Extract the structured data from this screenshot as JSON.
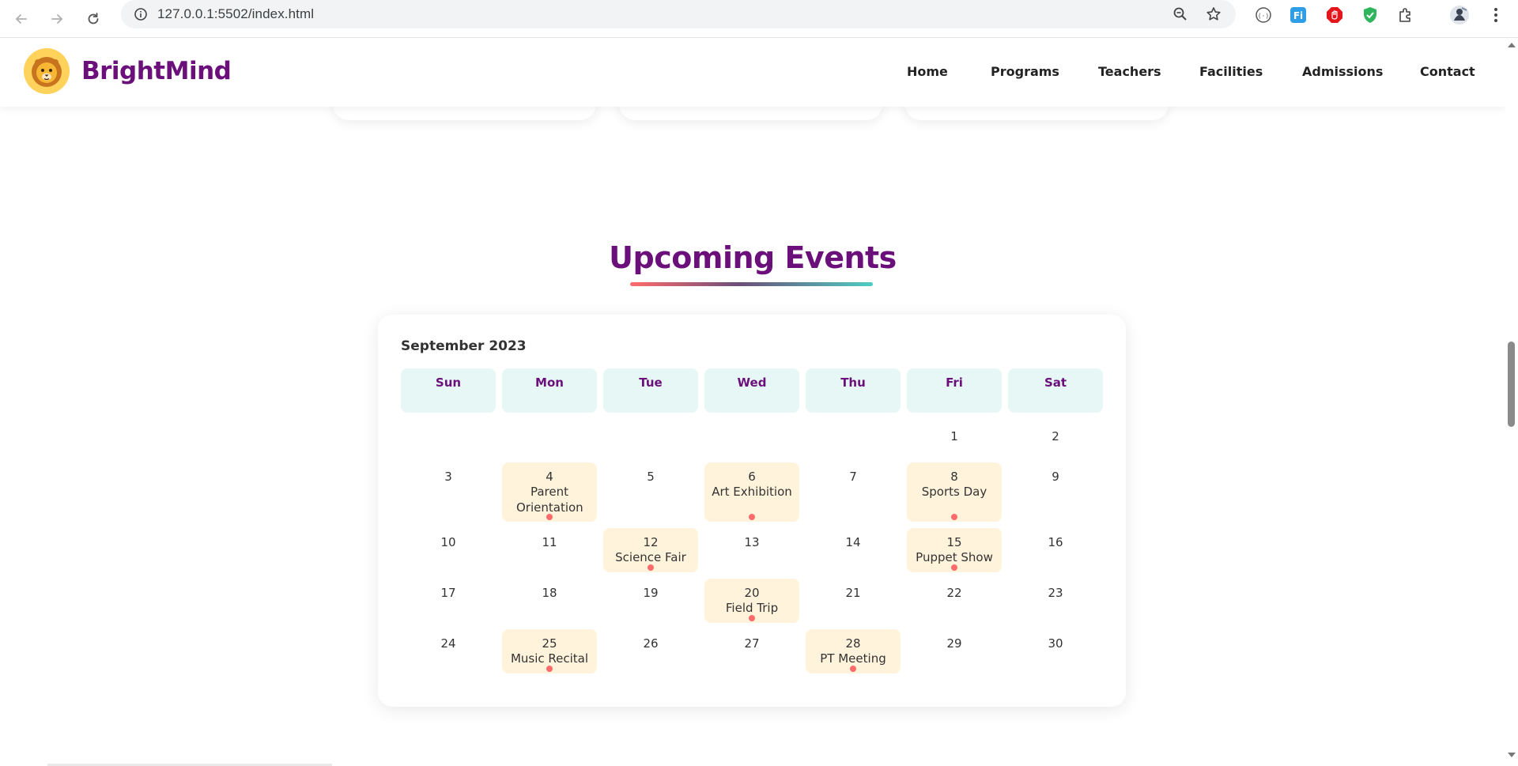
{
  "browser": {
    "url": "127.0.0.1:5502/index.html"
  },
  "site": {
    "brand": "BrightMind",
    "nav": [
      "Home",
      "Programs",
      "Teachers",
      "Facilities",
      "Admissions",
      "Contact"
    ]
  },
  "section": {
    "title": "Upcoming Events"
  },
  "calendar": {
    "month": "September 2023",
    "weekdays": [
      "Sun",
      "Mon",
      "Tue",
      "Wed",
      "Thu",
      "Fri",
      "Sat"
    ],
    "days": [
      {
        "num": "1"
      },
      {
        "num": "2"
      },
      {
        "num": "3"
      },
      {
        "num": "4",
        "event": "Parent Orientation"
      },
      {
        "num": "5"
      },
      {
        "num": "6",
        "event": "Art Exhibition"
      },
      {
        "num": "7"
      },
      {
        "num": "8",
        "event": "Sports Day"
      },
      {
        "num": "9"
      },
      {
        "num": "10"
      },
      {
        "num": "11"
      },
      {
        "num": "12",
        "event": "Science Fair"
      },
      {
        "num": "13"
      },
      {
        "num": "14"
      },
      {
        "num": "15",
        "event": "Puppet Show"
      },
      {
        "num": "16"
      },
      {
        "num": "17"
      },
      {
        "num": "18"
      },
      {
        "num": "19"
      },
      {
        "num": "20",
        "event": "Field Trip"
      },
      {
        "num": "21"
      },
      {
        "num": "22"
      },
      {
        "num": "23"
      },
      {
        "num": "24"
      },
      {
        "num": "25",
        "event": "Music Recital"
      },
      {
        "num": "26"
      },
      {
        "num": "27"
      },
      {
        "num": "28",
        "event": "PT Meeting"
      },
      {
        "num": "29"
      },
      {
        "num": "30"
      }
    ]
  },
  "colors": {
    "brand": "#6b0f7a",
    "event_bg": "#fff3dc",
    "weekday_bg": "#e6f7f6",
    "dot": "#ff6b6b"
  }
}
